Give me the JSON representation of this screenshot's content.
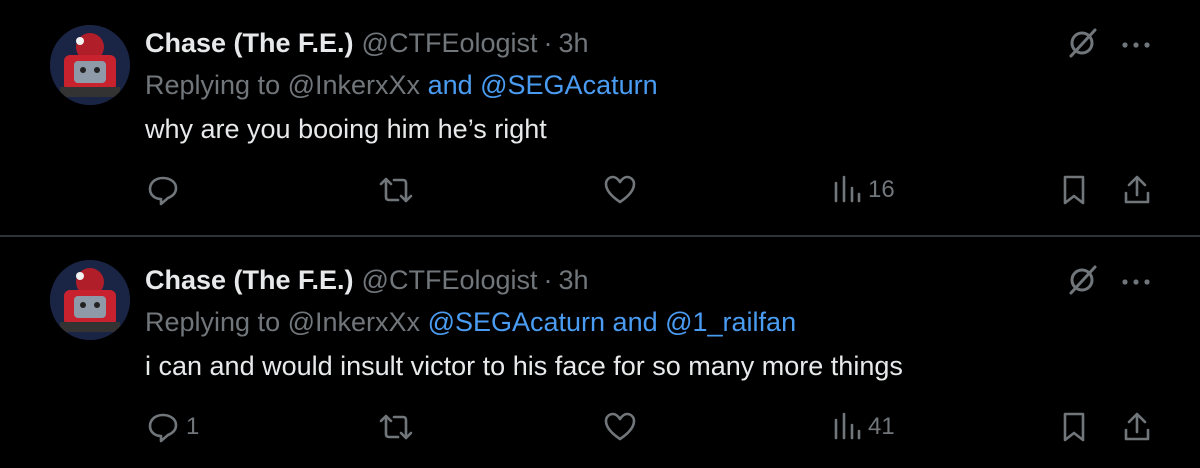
{
  "tweets": [
    {
      "name": "Chase (The F.E.)",
      "handle": "@CTFEologist",
      "dot": "·",
      "time": "3h",
      "reply_prefix": "Replying to",
      "reply_user1": "@InkerxXx",
      "reply_rest": "and @SEGAcaturn",
      "text": "why are you booing him he’s right",
      "reply_count": "",
      "retweet_count": "",
      "like_count": "",
      "view_count": "16"
    },
    {
      "name": "Chase (The F.E.)",
      "handle": "@CTFEologist",
      "dot": "·",
      "time": "3h",
      "reply_prefix": "Replying to",
      "reply_user1": "@InkerxXx",
      "reply_rest": "@SEGAcaturn and @1_railfan",
      "text": "i can and would insult victor to his face for so many more things",
      "reply_count": "1",
      "retweet_count": "",
      "like_count": "",
      "view_count": "41"
    }
  ],
  "icons": {
    "grok": "grok-icon",
    "more": "more-icon",
    "reply": "reply-icon",
    "retweet": "retweet-icon",
    "like": "like-icon",
    "views": "views-icon",
    "bookmark": "bookmark-icon",
    "share": "share-icon"
  },
  "colors": {
    "background": "#000000",
    "text": "#e7e9ea",
    "muted": "#71767b",
    "link": "#4a9cf2",
    "divider": "#2f3336"
  }
}
